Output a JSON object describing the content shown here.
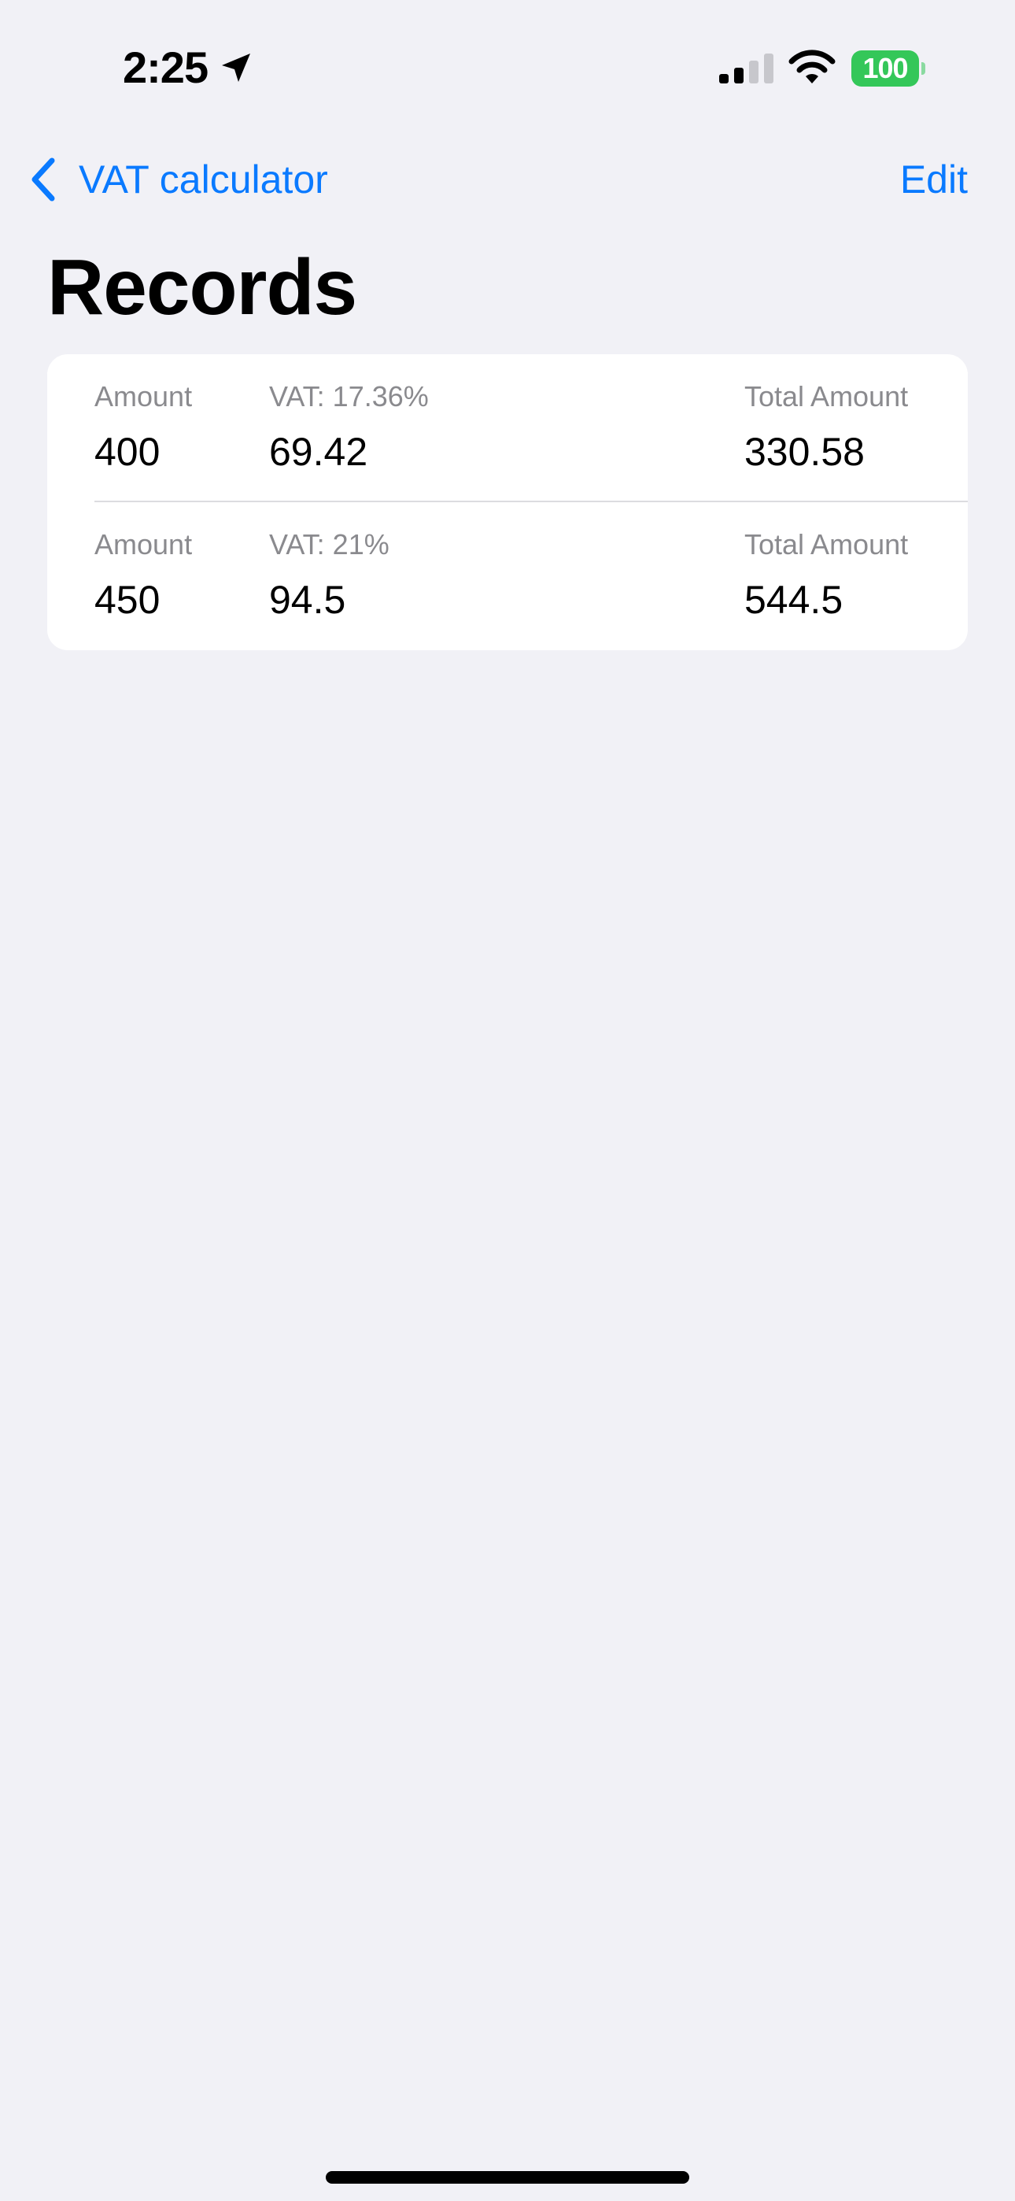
{
  "status_bar": {
    "time": "2:25",
    "battery_level": "100",
    "battery_color": "#34c759"
  },
  "nav": {
    "back_label": "VAT calculator",
    "edit_label": "Edit",
    "accent_color": "#0a7aff"
  },
  "page": {
    "title": "Records"
  },
  "records": [
    {
      "amount_label": "Amount",
      "amount": "400",
      "vat_label": "VAT: 17.36%",
      "vat": "69.42",
      "total_label": "Total Amount",
      "total": "330.58"
    },
    {
      "amount_label": "Amount",
      "amount": "450",
      "vat_label": "VAT: 21%",
      "vat": "94.5",
      "total_label": "Total Amount",
      "total": "544.5"
    }
  ],
  "icons": {
    "location": "location-arrow-icon",
    "signal": "cellular-signal-icon",
    "wifi": "wifi-icon",
    "back": "chevron-left-icon"
  }
}
